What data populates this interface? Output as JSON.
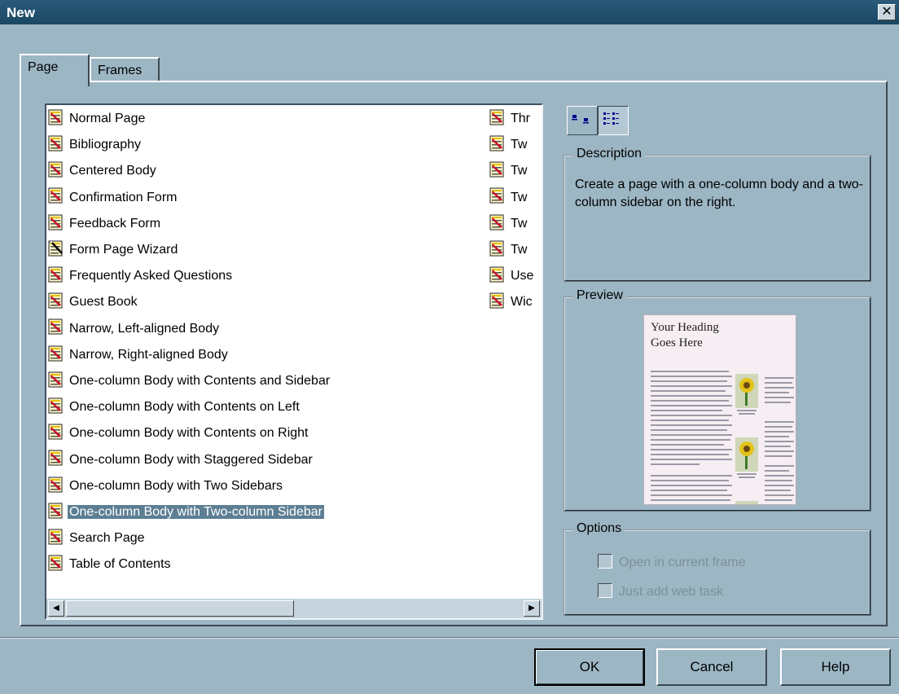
{
  "window": {
    "title": "New",
    "close_label": "✕"
  },
  "tabs": [
    {
      "label": "Page"
    },
    {
      "label": "Frames"
    }
  ],
  "templates_col1": [
    {
      "label": "Normal Page"
    },
    {
      "label": "Bibliography"
    },
    {
      "label": "Centered Body"
    },
    {
      "label": "Confirmation Form"
    },
    {
      "label": "Feedback Form"
    },
    {
      "label": "Form Page Wizard",
      "icon": "wizard-icon"
    },
    {
      "label": "Frequently Asked Questions"
    },
    {
      "label": "Guest Book"
    },
    {
      "label": "Narrow, Left-aligned Body"
    },
    {
      "label": "Narrow, Right-aligned Body"
    },
    {
      "label": "One-column Body with Contents and Sidebar"
    },
    {
      "label": "One-column Body with Contents on Left"
    },
    {
      "label": "One-column Body with Contents on Right"
    },
    {
      "label": "One-column Body with Staggered Sidebar"
    },
    {
      "label": "One-column Body with Two Sidebars"
    },
    {
      "label": "One-column Body with Two-column Sidebar",
      "selected": true
    },
    {
      "label": "Search Page"
    },
    {
      "label": "Table of Contents"
    }
  ],
  "templates_col2": [
    {
      "label": "Thr"
    },
    {
      "label": "Tw"
    },
    {
      "label": "Tw"
    },
    {
      "label": "Tw"
    },
    {
      "label": "Tw"
    },
    {
      "label": "Tw"
    },
    {
      "label": "Use"
    },
    {
      "label": "Wic"
    }
  ],
  "description": {
    "legend": "Description",
    "text": "Create a page with a one-column body and a two-column sidebar on the right."
  },
  "preview": {
    "legend": "Preview",
    "heading": "Your Heading Goes Here"
  },
  "options": {
    "legend": "Options",
    "open_in_current_frame": "Open in current frame",
    "just_add_web_task": "Just add web task"
  },
  "buttons": {
    "ok": "OK",
    "cancel": "Cancel",
    "help": "Help"
  },
  "colors": {
    "selection": "#5d7f94",
    "dialog_bg": "#9cb6c4",
    "titlebar": "#1f4d6b"
  },
  "icons": {
    "template": "page-template-icon",
    "large_icons": "large-icons-view-icon",
    "list": "list-view-icon"
  }
}
